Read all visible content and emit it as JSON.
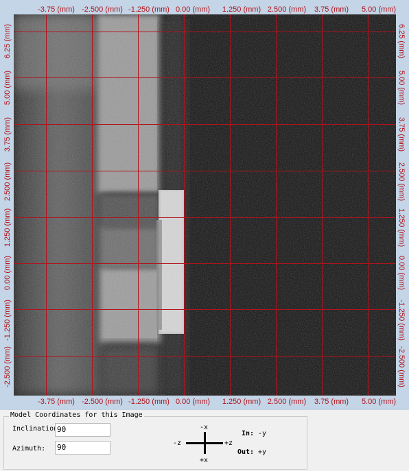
{
  "axis_units_label_format": "(mm)",
  "x_ticks": [
    "-3.75 (mm)",
    "-2.500 (mm)",
    "-1.250 (mm)",
    "0.00 (mm)",
    "1.250 (mm)",
    "2.500 (mm)",
    "3.75 (mm)",
    "5.00 (mm)"
  ],
  "y_ticks": [
    "6.25 (mm)",
    "5.00 (mm)",
    "3.75 (mm)",
    "2.500 (mm)",
    "1.250 (mm)",
    "0.00 (mm)",
    "-1.250 (mm)",
    "-2.500 (mm)"
  ],
  "grid_color": "#b3121c",
  "background_color": "#c3d5e6",
  "coordinates_panel": {
    "title": "Model Coordinates for this Image",
    "inclination_label": "Inclination:",
    "inclination_value": "90",
    "azimuth_label": "Azimuth:",
    "azimuth_value": "90"
  },
  "orientation": {
    "top": "-x",
    "bottom": "+x",
    "left": "-z",
    "right": "+z",
    "in_label": "In:",
    "in_value": "-y",
    "out_label": "Out:",
    "out_value": "+y"
  }
}
